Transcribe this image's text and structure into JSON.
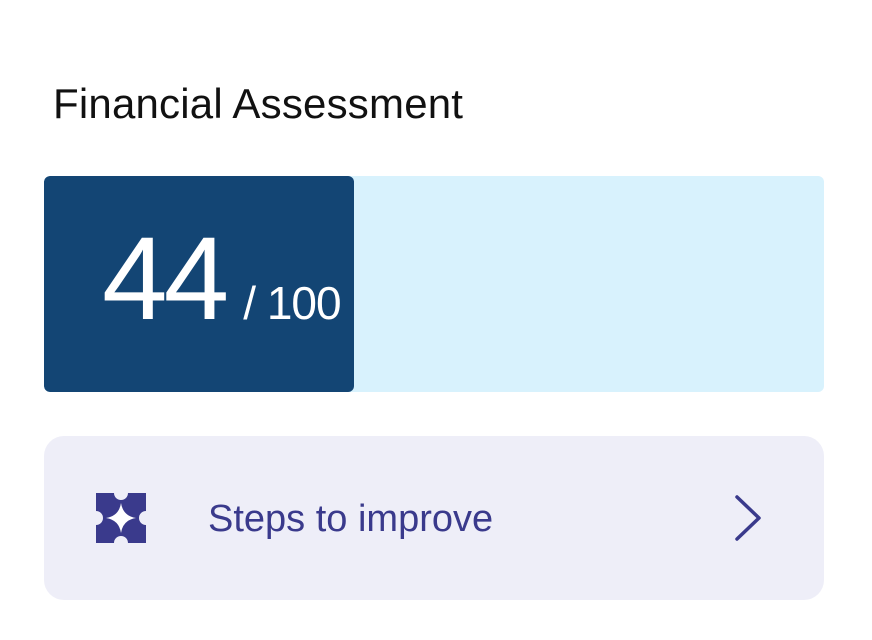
{
  "card": {
    "title": "Financial Assessment"
  },
  "score": {
    "value": "44",
    "max_label": "/ 100",
    "fraction": 0.44,
    "fill_color": "#134574",
    "track_color": "#d8f2fd"
  },
  "steps": {
    "label": "Steps to improve",
    "icon": "sparkle-icon",
    "chevron_icon": "chevron-right-icon",
    "accent_color": "#3a3a8c",
    "background_color": "#eeeef8"
  }
}
